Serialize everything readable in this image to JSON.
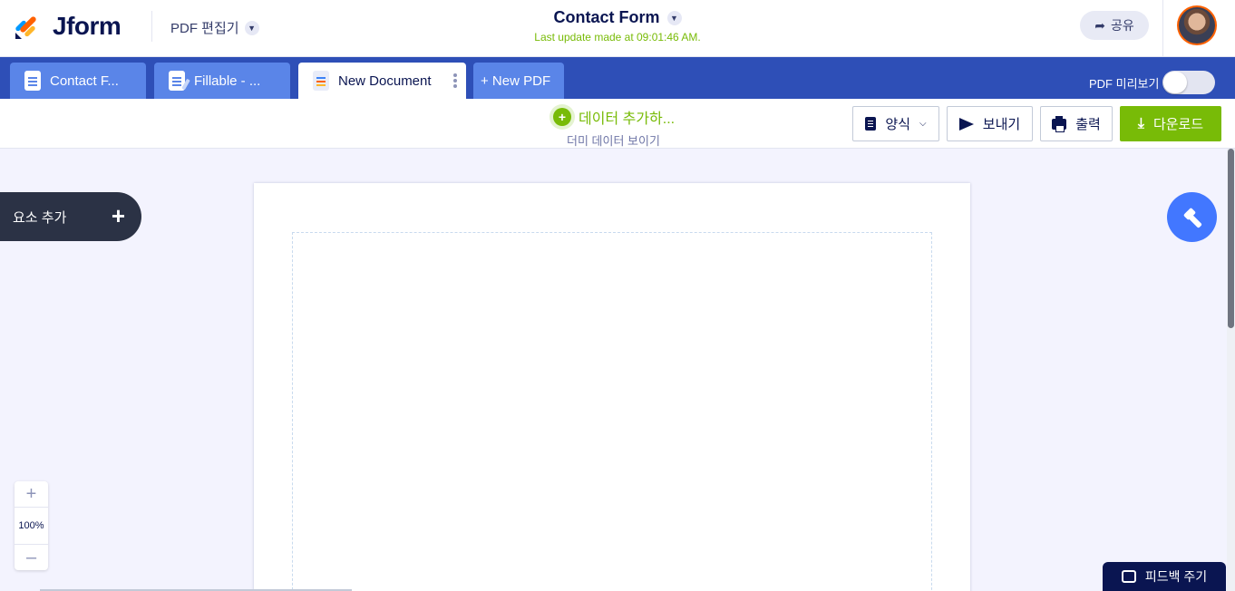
{
  "header": {
    "logo_text": "Jform",
    "product_name": "PDF 편집기",
    "doc_title": "Contact Form",
    "last_update": "Last update made at 09:01:46 AM.",
    "share_label": "공유"
  },
  "tabs": [
    {
      "label": "Contact F..."
    },
    {
      "label": "Fillable - ..."
    },
    {
      "label": "New Document"
    },
    {
      "label": "+ New PDF"
    }
  ],
  "preview": {
    "label": "PDF 미리보기",
    "enabled": false
  },
  "toolbar": {
    "add_data_label": "데이터 추가하...",
    "dummy_data_label": "더미 데이터 보이기",
    "form_label": "양식",
    "send_label": "보내기",
    "print_label": "출력",
    "download_label": "다운로드"
  },
  "sidebar": {
    "add_element_label": "요소 추가"
  },
  "zoom": {
    "value": "100%"
  },
  "feedback": {
    "label": "피드백 주기"
  },
  "colors": {
    "brand_navy": "#0a1551",
    "tab_bar": "#2e4fb7",
    "accent_green": "#78bb07",
    "accent_blue": "#4277ff"
  }
}
